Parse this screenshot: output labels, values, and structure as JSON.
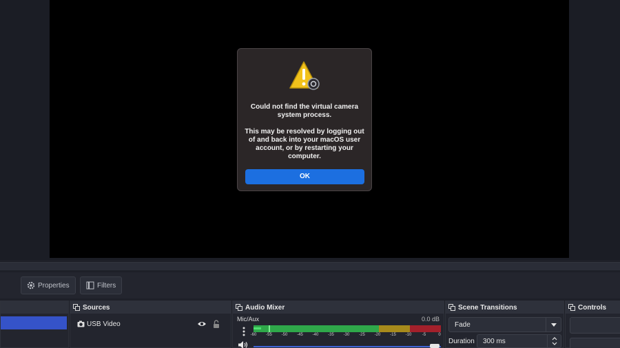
{
  "dialog": {
    "title": "Could not find the virtual camera system process.",
    "body": "This may be resolved by logging out of and back into your macOS user account, or by restarting your computer.",
    "ok_label": "OK"
  },
  "toolbar": {
    "properties_label": "Properties",
    "filters_label": "Filters"
  },
  "docks": {
    "sources": {
      "title": "Sources",
      "items": [
        {
          "label": "USB Video",
          "visible": true,
          "locked": false
        }
      ]
    },
    "audio_mixer": {
      "title": "Audio Mixer",
      "channel_name": "Mic/Aux",
      "level_db": "0.0 dB",
      "ticks": [
        "-60",
        "-55",
        "-50",
        "-45",
        "-40",
        "-35",
        "-30",
        "-25",
        "-20",
        "-15",
        "-10",
        "-5",
        "0"
      ]
    },
    "scene_transitions": {
      "title": "Scene Transitions",
      "transition": "Fade",
      "duration_label": "Duration",
      "duration_value": "300 ms"
    },
    "controls": {
      "title": "Controls"
    }
  },
  "colors": {
    "accent": "#1c6fe0",
    "selected_scene": "#3553c8",
    "meter_green": "#2fa84a",
    "meter_yellow": "#a78a1c",
    "meter_red": "#a3202b"
  }
}
